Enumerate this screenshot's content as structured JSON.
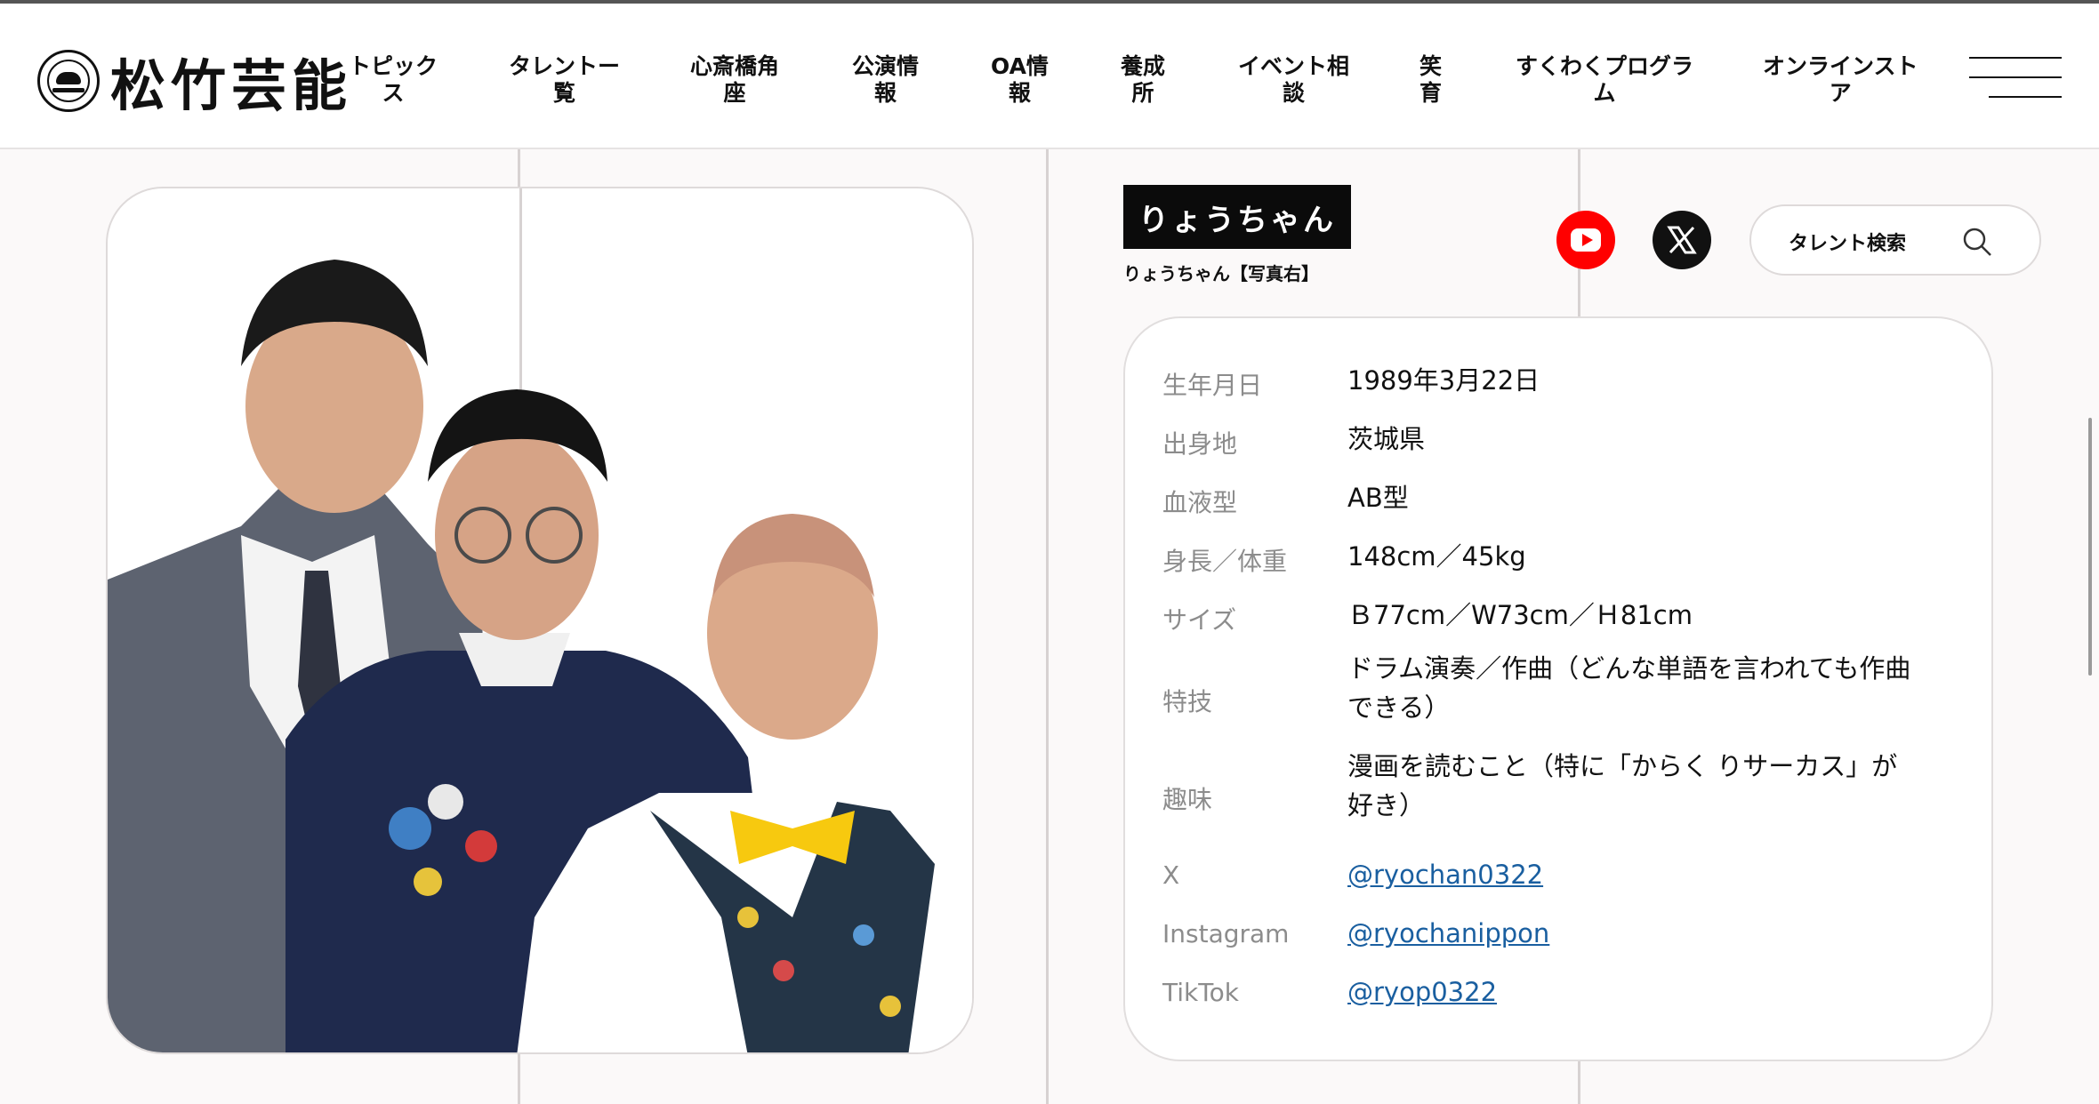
{
  "header": {
    "logo_text": "松竹芸能",
    "nav": [
      {
        "lines": [
          "トピック",
          "ス"
        ]
      },
      {
        "lines": [
          "タレントー",
          "覧"
        ]
      },
      {
        "lines": [
          "心斎橋角",
          "座"
        ]
      },
      {
        "lines": [
          "公演情",
          "報"
        ]
      },
      {
        "lines": [
          "OA情",
          "報"
        ]
      },
      {
        "lines": [
          "養成",
          "所"
        ]
      },
      {
        "lines": [
          "イベント相",
          "談"
        ]
      },
      {
        "lines": [
          "笑",
          "育"
        ]
      },
      {
        "lines": [
          "すくわくプログラ",
          "ム"
        ]
      },
      {
        "lines": [
          "オンラインスト",
          "ア"
        ]
      }
    ]
  },
  "talent": {
    "name": "りょうちゃん",
    "photo_caption": "りょうちゃん【写真右】"
  },
  "social_icons": [
    "youtube-icon",
    "x-icon"
  ],
  "search": {
    "label": "タレント検索"
  },
  "profile": {
    "rows": [
      {
        "label": "生年月日",
        "value": "1989年3月22日"
      },
      {
        "label": "出身地",
        "value": "茨城県"
      },
      {
        "label": "血液型",
        "value": "AB型"
      },
      {
        "label": "身長／体重",
        "value": "148cm／45kg"
      },
      {
        "label": "サイズ",
        "value": "Ｂ77cm／W73cm／Ｈ81cm"
      },
      {
        "label": "特技",
        "value_lines": [
          "ドラム演奏／作曲（どんな単語を言われても作曲",
          "できる）"
        ]
      },
      {
        "label": "趣味",
        "value_lines": [
          "漫画を読むこと（特に「からく りサーカス」が",
          "好き）"
        ]
      },
      {
        "label": "X",
        "link": "@ryochan0322"
      },
      {
        "label": "Instagram",
        "link": "@ryochanippon"
      },
      {
        "label": "TikTok",
        "link": "@ryop0322"
      }
    ]
  },
  "colors": {
    "link": "#1a5fa0",
    "youtube": "#ff0000",
    "name_box": "#0b0b0b"
  }
}
